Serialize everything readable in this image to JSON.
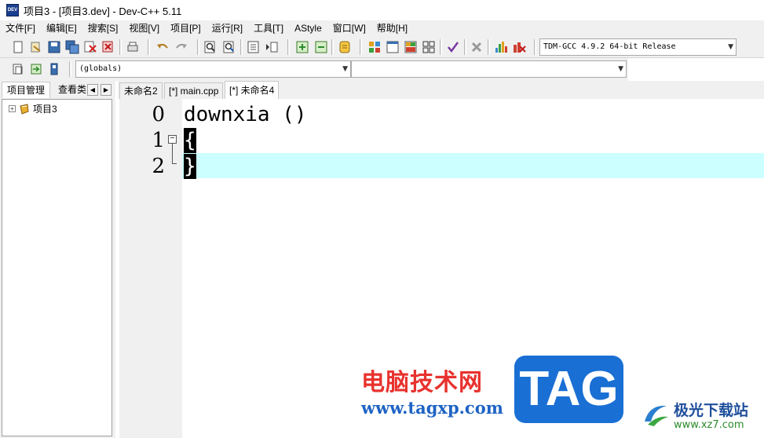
{
  "window": {
    "title": "项目3 - [项目3.dev] - Dev-C++ 5.11",
    "icon_label": "DEV"
  },
  "menu": [
    "文件[F]",
    "编辑[E]",
    "搜索[S]",
    "视图[V]",
    "项目[P]",
    "运行[R]",
    "工具[T]",
    "AStyle",
    "窗口[W]",
    "帮助[H]"
  ],
  "toolbar": {
    "compiler": "TDM-GCC 4.9.2 64-bit Release",
    "scope": "(globals)",
    "function": ""
  },
  "left_panel": {
    "tabs": [
      "项目管理",
      "查看类"
    ],
    "tree": {
      "project": "项目3",
      "expander": "+"
    }
  },
  "editor": {
    "tabs": [
      "未命名2",
      "[*] main.cpp",
      "[*] 未命名4"
    ],
    "active_tab": 2,
    "lines": [
      {
        "num": "0",
        "code": "downxia ()"
      },
      {
        "num": "1",
        "code": "{"
      },
      {
        "num": "2",
        "code": "}"
      }
    ]
  },
  "watermark": {
    "cn_text": "电脑技术网",
    "url": "www.tagxp.com",
    "tag": "TAG",
    "site_name": "极光下载站",
    "site_url": "www.xz7.com"
  },
  "colors": {
    "current_line": "#ccffff",
    "tag_blue": "#1a6fd4",
    "wm_red": "#e8322e"
  }
}
